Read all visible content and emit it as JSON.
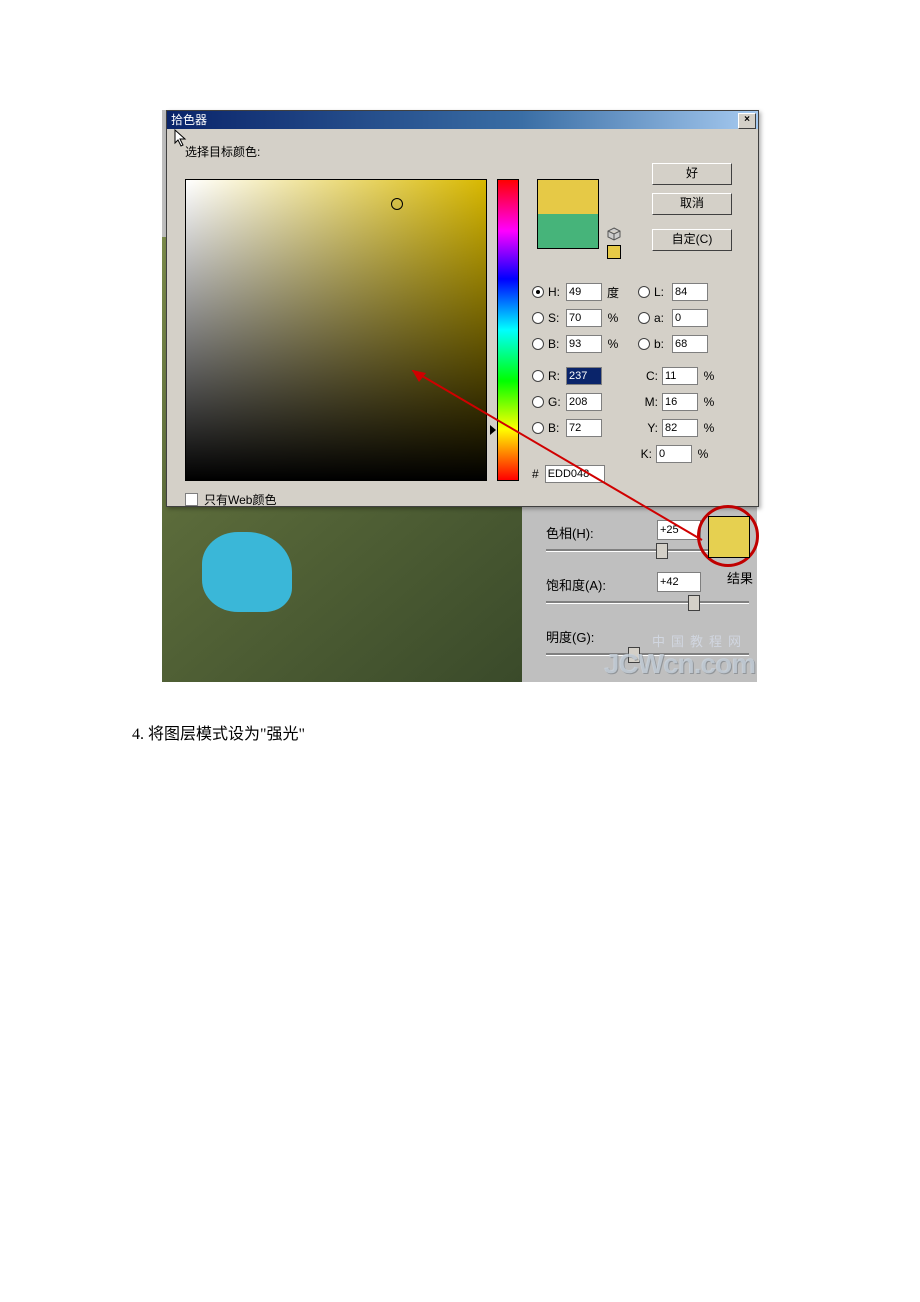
{
  "dialog": {
    "title": "拾色器",
    "prompt": "选择目标颜色:",
    "buttons": {
      "ok": "好",
      "cancel": "取消",
      "custom": "自定(C)"
    },
    "close": "×",
    "webOnly": "只有Web颜色",
    "hashLabel": "#",
    "hex": "EDD048",
    "fields": {
      "H": {
        "label": "H:",
        "value": "49",
        "unit": "度"
      },
      "S": {
        "label": "S:",
        "value": "70",
        "unit": "%"
      },
      "Bv": {
        "label": "B:",
        "value": "93",
        "unit": "%"
      },
      "R": {
        "label": "R:",
        "value": "237"
      },
      "G": {
        "label": "G:",
        "value": "208"
      },
      "Bb": {
        "label": "B:",
        "value": "72"
      },
      "L": {
        "label": "L:",
        "value": "84"
      },
      "a": {
        "label": "a:",
        "value": "0"
      },
      "b": {
        "label": "b:",
        "value": "68"
      },
      "C": {
        "label": "C:",
        "value": "11",
        "unit": "%"
      },
      "M": {
        "label": "M:",
        "value": "16",
        "unit": "%"
      },
      "Y": {
        "label": "Y:",
        "value": "82",
        "unit": "%"
      },
      "K": {
        "label": "K:",
        "value": "0",
        "unit": "%"
      }
    }
  },
  "sliders": {
    "hue": {
      "label": "色相(H):",
      "value": "+25"
    },
    "sat": {
      "label": "饱和度(A):",
      "value": "+42"
    },
    "lig": {
      "label": "明度(G):"
    },
    "resultLabel": "结果"
  },
  "watermark": {
    "small": "中国教程网",
    "big": "JCWcn.com"
  },
  "caption": "4. 将图层模式设为\"强光\""
}
